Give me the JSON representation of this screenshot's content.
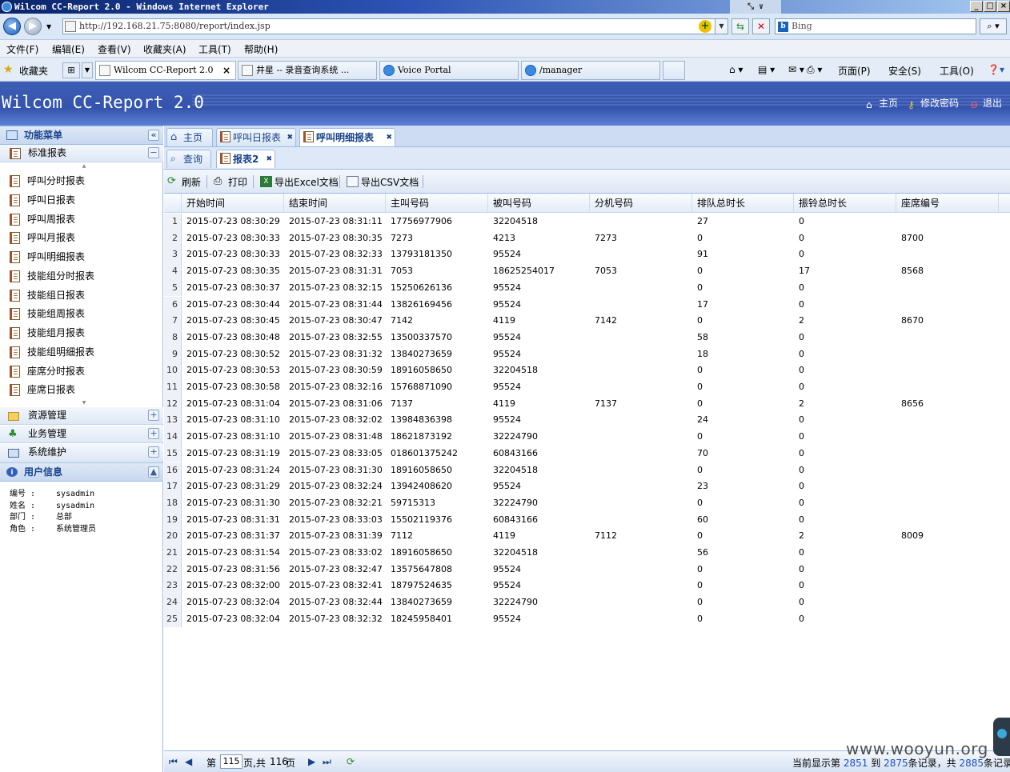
{
  "window": {
    "title": "Wilcom CC-Report 2.0 - Windows Internet Explorer",
    "controls": [
      "_",
      "□",
      "×"
    ]
  },
  "address": {
    "url": "http://192.168.21.75:8080/report/index.jsp",
    "search_placeholder": "Bing"
  },
  "menu": [
    "文件(F)",
    "编辑(E)",
    "查看(V)",
    "收藏夹(A)",
    "工具(T)",
    "帮助(H)"
  ],
  "favorites": {
    "label": "收藏夹",
    "tabs": [
      {
        "label": "Wilcom CC-Report 2.0",
        "active": true
      },
      {
        "label": "井星 -- 录音查询系统 ...",
        "active": false
      },
      {
        "label": "Voice Portal",
        "active": false
      },
      {
        "label": "/manager",
        "active": false
      }
    ],
    "tools": [
      "页面(P)",
      "安全(S)",
      "工具(O)"
    ]
  },
  "app": {
    "title": "Wilcom CC-Report 2.0",
    "header_links": {
      "home": "主页",
      "change_password": "修改密码",
      "logout": "退出"
    }
  },
  "sidebar": {
    "panel_title": "功能菜单",
    "standard_reports": "标准报表",
    "items": [
      "呼叫分时报表",
      "呼叫日报表",
      "呼叫周报表",
      "呼叫月报表",
      "呼叫明细报表",
      "技能组分时报表",
      "技能组日报表",
      "技能组周报表",
      "技能组月报表",
      "技能组明细报表",
      "座席分时报表",
      "座席日报表"
    ],
    "groups": [
      "资源管理",
      "业务管理",
      "系统维护"
    ],
    "user_panel_title": "用户信息",
    "user": [
      {
        "label": "编号 :",
        "value": "sysadmin"
      },
      {
        "label": "姓名 :",
        "value": "sysadmin"
      },
      {
        "label": "部门 :",
        "value": "总部"
      },
      {
        "label": "角色 :",
        "value": "系统管理员"
      }
    ]
  },
  "tabs": [
    {
      "label": "主页",
      "active": false
    },
    {
      "label": "呼叫日报表",
      "active": false
    },
    {
      "label": "呼叫明细报表",
      "active": true
    }
  ],
  "subtabs": [
    {
      "label": "查询",
      "active": false
    },
    {
      "label": "报表2",
      "active": true
    }
  ],
  "toolbar": {
    "refresh": "刷新",
    "print": "打印",
    "export_excel": "导出Excel文档",
    "export_csv": "导出CSV文档"
  },
  "grid": {
    "columns": [
      "开始时间",
      "结束时间",
      "主叫号码",
      "被叫号码",
      "分机号码",
      "排队总时长",
      "振铃总时长",
      "座席编号"
    ],
    "rows": [
      [
        "1",
        "2015-07-23 08:30:29",
        "2015-07-23 08:31:11",
        "17756977906",
        "32204518",
        "",
        "27",
        "0",
        ""
      ],
      [
        "2",
        "2015-07-23 08:30:33",
        "2015-07-23 08:30:35",
        "7273",
        "4213",
        "7273",
        "0",
        "0",
        "8700"
      ],
      [
        "3",
        "2015-07-23 08:30:33",
        "2015-07-23 08:32:33",
        "13793181350",
        "95524",
        "",
        "91",
        "0",
        ""
      ],
      [
        "4",
        "2015-07-23 08:30:35",
        "2015-07-23 08:31:31",
        "7053",
        "18625254017",
        "7053",
        "0",
        "17",
        "8568"
      ],
      [
        "5",
        "2015-07-23 08:30:37",
        "2015-07-23 08:32:15",
        "15250626136",
        "95524",
        "",
        "0",
        "0",
        ""
      ],
      [
        "6",
        "2015-07-23 08:30:44",
        "2015-07-23 08:31:44",
        "13826169456",
        "95524",
        "",
        "17",
        "0",
        ""
      ],
      [
        "7",
        "2015-07-23 08:30:45",
        "2015-07-23 08:30:47",
        "7142",
        "4119",
        "7142",
        "0",
        "2",
        "8670"
      ],
      [
        "8",
        "2015-07-23 08:30:48",
        "2015-07-23 08:32:55",
        "13500337570",
        "95524",
        "",
        "58",
        "0",
        ""
      ],
      [
        "9",
        "2015-07-23 08:30:52",
        "2015-07-23 08:31:32",
        "13840273659",
        "95524",
        "",
        "18",
        "0",
        ""
      ],
      [
        "10",
        "2015-07-23 08:30:53",
        "2015-07-23 08:30:59",
        "18916058650",
        "32204518",
        "",
        "0",
        "0",
        ""
      ],
      [
        "11",
        "2015-07-23 08:30:58",
        "2015-07-23 08:32:16",
        "15768871090",
        "95524",
        "",
        "0",
        "0",
        ""
      ],
      [
        "12",
        "2015-07-23 08:31:04",
        "2015-07-23 08:31:06",
        "7137",
        "4119",
        "7137",
        "0",
        "2",
        "8656"
      ],
      [
        "13",
        "2015-07-23 08:31:10",
        "2015-07-23 08:32:02",
        "13984836398",
        "95524",
        "",
        "24",
        "0",
        ""
      ],
      [
        "14",
        "2015-07-23 08:31:10",
        "2015-07-23 08:31:48",
        "18621873192",
        "32224790",
        "",
        "0",
        "0",
        ""
      ],
      [
        "15",
        "2015-07-23 08:31:19",
        "2015-07-23 08:33:05",
        "018601375242",
        "60843166",
        "",
        "70",
        "0",
        ""
      ],
      [
        "16",
        "2015-07-23 08:31:24",
        "2015-07-23 08:31:30",
        "18916058650",
        "32204518",
        "",
        "0",
        "0",
        ""
      ],
      [
        "17",
        "2015-07-23 08:31:29",
        "2015-07-23 08:32:24",
        "13942408620",
        "95524",
        "",
        "23",
        "0",
        ""
      ],
      [
        "18",
        "2015-07-23 08:31:30",
        "2015-07-23 08:32:21",
        "59715313",
        "32224790",
        "",
        "0",
        "0",
        ""
      ],
      [
        "19",
        "2015-07-23 08:31:31",
        "2015-07-23 08:33:03",
        "15502119376",
        "60843166",
        "",
        "60",
        "0",
        ""
      ],
      [
        "20",
        "2015-07-23 08:31:37",
        "2015-07-23 08:31:39",
        "7112",
        "4119",
        "7112",
        "0",
        "2",
        "8009"
      ],
      [
        "21",
        "2015-07-23 08:31:54",
        "2015-07-23 08:33:02",
        "18916058650",
        "32204518",
        "",
        "56",
        "0",
        ""
      ],
      [
        "22",
        "2015-07-23 08:31:56",
        "2015-07-23 08:32:47",
        "13575647808",
        "95524",
        "",
        "0",
        "0",
        ""
      ],
      [
        "23",
        "2015-07-23 08:32:00",
        "2015-07-23 08:32:41",
        "18797524635",
        "95524",
        "",
        "0",
        "0",
        ""
      ],
      [
        "24",
        "2015-07-23 08:32:04",
        "2015-07-23 08:32:44",
        "13840273659",
        "32224790",
        "",
        "0",
        "0",
        ""
      ],
      [
        "25",
        "2015-07-23 08:32:04",
        "2015-07-23 08:32:32",
        "18245958401",
        "95524",
        "",
        "0",
        "0",
        ""
      ]
    ]
  },
  "paging": {
    "page_prefix": "第",
    "current_page": "115",
    "page_suffix": "页,共",
    "total_pages": "116",
    "pages_unit": "页",
    "showing_prefix": "当前显示第",
    "from": "2851",
    "to_word": "到",
    "to": "2875",
    "records_word": "条记录",
    "total_prefix": "，共",
    "total": "2885",
    "total_suffix": "条记录"
  },
  "watermark": "www.wooyun.org"
}
